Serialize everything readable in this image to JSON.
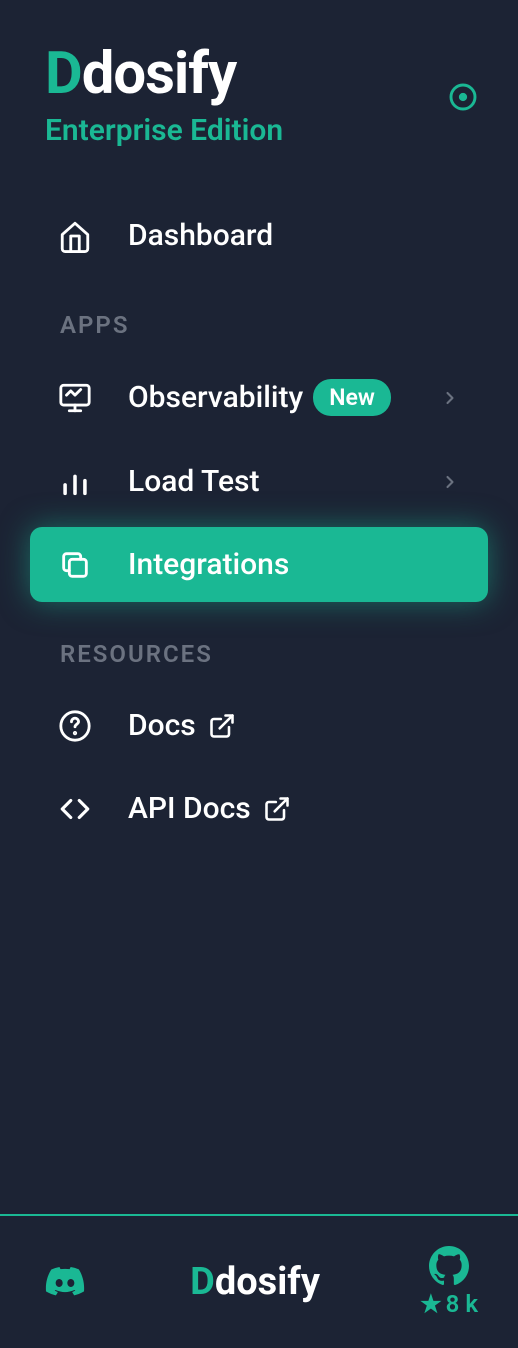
{
  "brand": {
    "name": "Ddosify",
    "edition": "Enterprise Edition"
  },
  "nav": {
    "dashboard": "Dashboard"
  },
  "sections": {
    "apps": {
      "title": "APPS",
      "items": [
        {
          "label": "Observability",
          "badge": "New"
        },
        {
          "label": "Load Test"
        },
        {
          "label": "Integrations"
        }
      ]
    },
    "resources": {
      "title": "RESOURCES",
      "items": [
        {
          "label": "Docs"
        },
        {
          "label": "API Docs"
        }
      ]
    }
  },
  "footer": {
    "logo": "Ddosify",
    "stars": "8 k"
  }
}
